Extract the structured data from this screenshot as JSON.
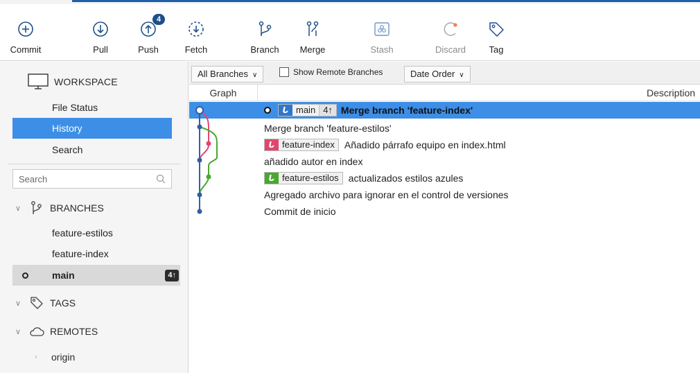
{
  "toolbar": {
    "commit": "Commit",
    "pull": "Pull",
    "push": "Push",
    "push_badge": "4",
    "fetch": "Fetch",
    "branch": "Branch",
    "merge": "Merge",
    "stash": "Stash",
    "discard": "Discard",
    "tag": "Tag"
  },
  "sidebar": {
    "workspace": "WORKSPACE",
    "items": [
      {
        "label": "File Status"
      },
      {
        "label": "History"
      },
      {
        "label": "Search"
      }
    ],
    "search_placeholder": "Search",
    "branches_title": "BRANCHES",
    "branches": [
      {
        "label": "feature-estilos"
      },
      {
        "label": "feature-index"
      },
      {
        "label": "main",
        "ahead": "4↑"
      }
    ],
    "tags_title": "TAGS",
    "remotes_title": "REMOTES",
    "remotes": [
      {
        "label": "origin"
      }
    ]
  },
  "filters": {
    "branches_select": "All Branches",
    "show_remote": "Show Remote Branches",
    "order_select": "Date Order"
  },
  "columns": {
    "graph": "Graph",
    "description": "Description"
  },
  "commits": [
    {
      "branch_tag": "main",
      "ahead": "4↑",
      "message": "Merge branch 'feature-index'"
    },
    {
      "message": "Merge branch 'feature-estilos'"
    },
    {
      "branch_tag": "feature-index",
      "message": "Añadido párrafo equipo en index.html"
    },
    {
      "message": "añadido autor en index"
    },
    {
      "branch_tag": "feature-estilos",
      "message": "actualizados estilos azules"
    },
    {
      "message": "Agregado archivo para ignorar en el control de versiones"
    },
    {
      "message": "Commit de inicio"
    }
  ],
  "colors": {
    "accent": "#3d8ee6",
    "main_branch": "#2f77cc",
    "feature_index": "#e2466f",
    "feature_estilos": "#49a830",
    "graph_blue": "#2f5fa0"
  }
}
